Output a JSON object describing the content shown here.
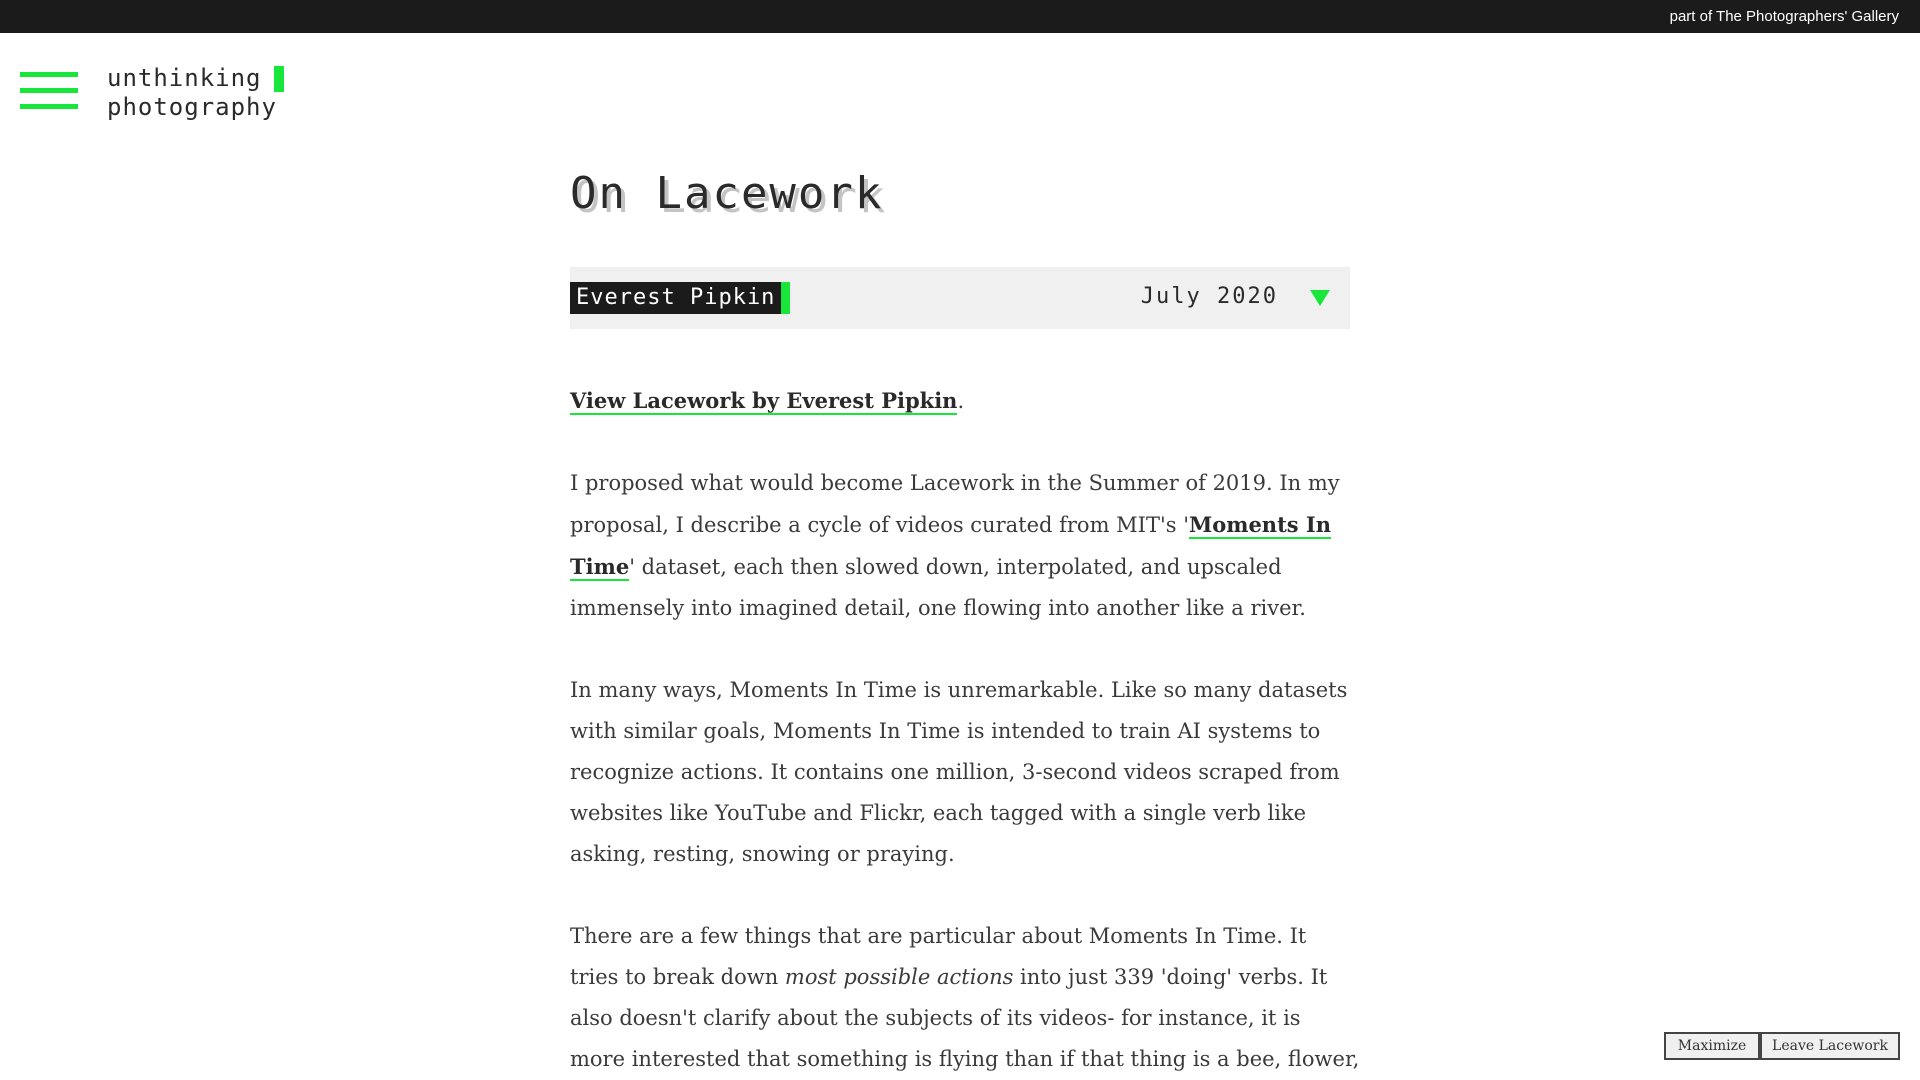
{
  "topbar": {
    "link": "part of The Photographers' Gallery"
  },
  "header": {
    "menu_icon": "hamburger-menu-icon",
    "logo_line1": "unthinking",
    "logo_line2": "photography"
  },
  "article": {
    "title": "On Lacework",
    "author": "Everest Pipkin",
    "date": "July 2020",
    "toggle_icon": "triangle-down-icon",
    "intro_link": "View Lacework by Everest Pipkin",
    "intro_end": ".",
    "p1": {
      "before": "I proposed what would become Lacework in the Summer of 2019. In my proposal, I describe a cycle of videos curated from MIT's '",
      "link": "Moments In Time",
      "after": "' dataset, each then slowed down, interpolated, and upscaled immensely into imagined detail, one flowing into another like a river."
    },
    "p2": "In many ways, Moments In Time is unremarkable. Like so many datasets with similar goals, Moments In Time is intended to train AI systems to recognize actions. It contains one million, 3-second videos scraped from websites like YouTube and Flickr, each tagged with a single verb like asking, resting, snowing or praying.",
    "p3": {
      "before": "There are a few things that are particular about Moments In Time. It tries to break down ",
      "emphasis": "most possible actions",
      "after": " into just 339 'doing' verbs. It also doesn't clarify about the subjects of its videos- for instance, it is more interested that something is flying than if that thing is a bee, flower,"
    }
  },
  "controls": {
    "maximize": "Maximize",
    "leave": "Leave Lacework"
  },
  "colors": {
    "accent": "#19e63a",
    "topbar": "#1b1b1b",
    "meta_bar": "#f0f0f0"
  }
}
